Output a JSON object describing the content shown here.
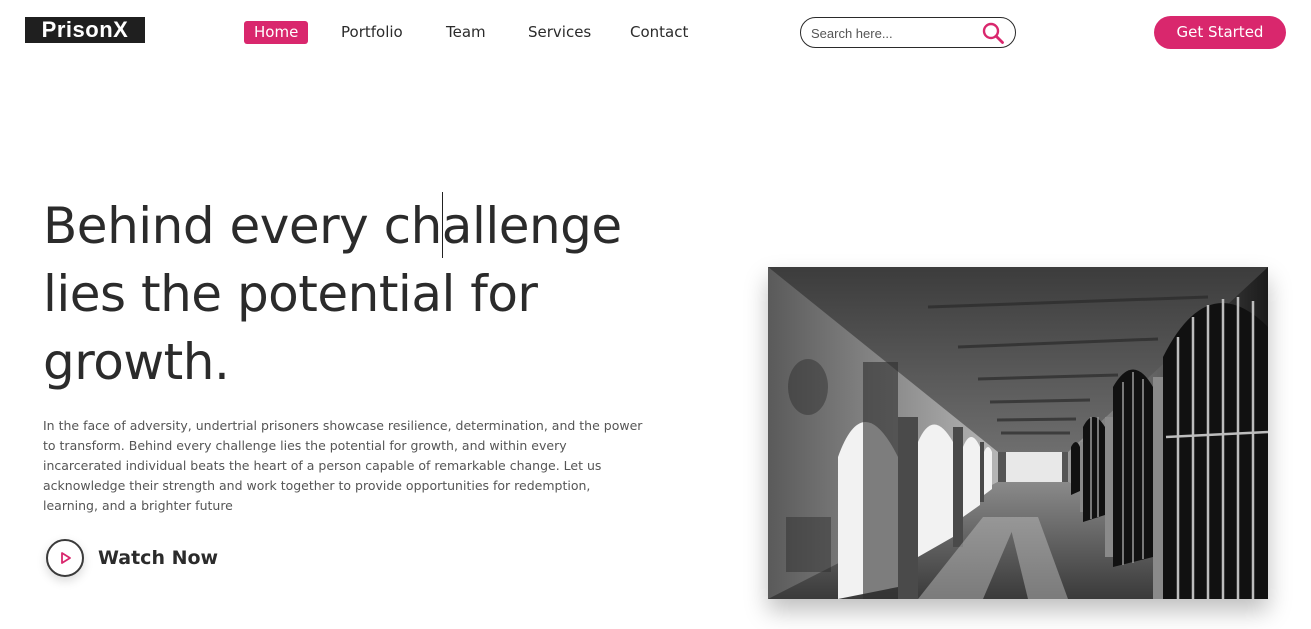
{
  "brand": {
    "logo_text": "PrisonX"
  },
  "nav": {
    "items": [
      {
        "label": "Home",
        "active": true
      },
      {
        "label": "Portfolio",
        "active": false
      },
      {
        "label": "Team",
        "active": false
      },
      {
        "label": "Services",
        "active": false
      },
      {
        "label": "Contact",
        "active": false
      }
    ]
  },
  "search": {
    "placeholder": "Search here...",
    "icon": "search-icon"
  },
  "cta": {
    "label": "Get Started"
  },
  "hero": {
    "headline_lines": [
      "Behind every challenge",
      "lies the potential for",
      "growth."
    ],
    "description": "In the face of adversity, undertrial prisoners showcase resilience, determination, and the power to transform. Behind every challenge lies the potential for growth, and within every incarcerated individual beats the heart of a person capable of remarkable change. Let us acknowledge their strength and work together to provide opportunities for redemption, learning, and a brighter future",
    "watch_label": "Watch Now",
    "watch_icon": "play-icon",
    "image_subject": "prison-corridor-photo"
  },
  "colors": {
    "accent": "#d9276d",
    "text": "#2b2b2b",
    "muted": "#555555",
    "logo_bg": "#1f1f1f"
  }
}
